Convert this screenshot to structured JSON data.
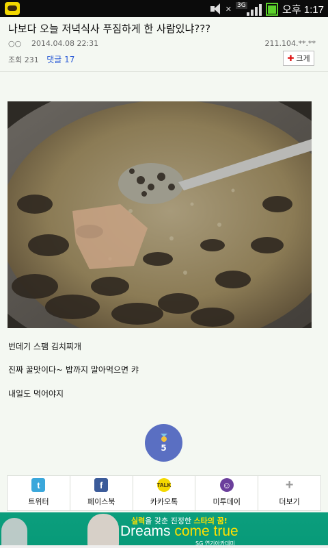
{
  "status": {
    "network": "3G",
    "ampm": "오후",
    "time": "1:17"
  },
  "post": {
    "title": "나보다 오늘 저녁식사 푸짐하게 한 사람있냐???",
    "author_marks": "○○",
    "datetime": "2014.04.08 22:31",
    "ip": "211.104.**.**",
    "views_label": "조회 231",
    "comments_label": "댓글 17",
    "enlarge_label": "크게",
    "body_lines": [
      "번데기 스팸 김치찌개",
      "진짜 꿀맛이다~ 밥까지 말아먹으면 캬",
      "내일도 먹어야지"
    ],
    "likes": "5"
  },
  "share": [
    {
      "label": "트위터",
      "icon": "twitter-icon"
    },
    {
      "label": "페이스북",
      "icon": "facebook-icon"
    },
    {
      "label": "카카오톡",
      "icon": "kakaotalk-icon"
    },
    {
      "label": "미투데이",
      "icon": "me2day-icon"
    },
    {
      "label": "더보기",
      "icon": "plus-icon"
    }
  ],
  "ad": {
    "tagline_prefix": "실력",
    "tagline_mid": "을 갖춘 진정한 ",
    "tagline_star": "스타의 꿈!",
    "headline_a": "Dreams ",
    "headline_b": "come true",
    "sub": "SG 연기아카데미"
  },
  "colors": {
    "accent": "#2a5bd6",
    "like_badge": "#5a6fc2",
    "ad_bg": "#0c9e7d"
  }
}
